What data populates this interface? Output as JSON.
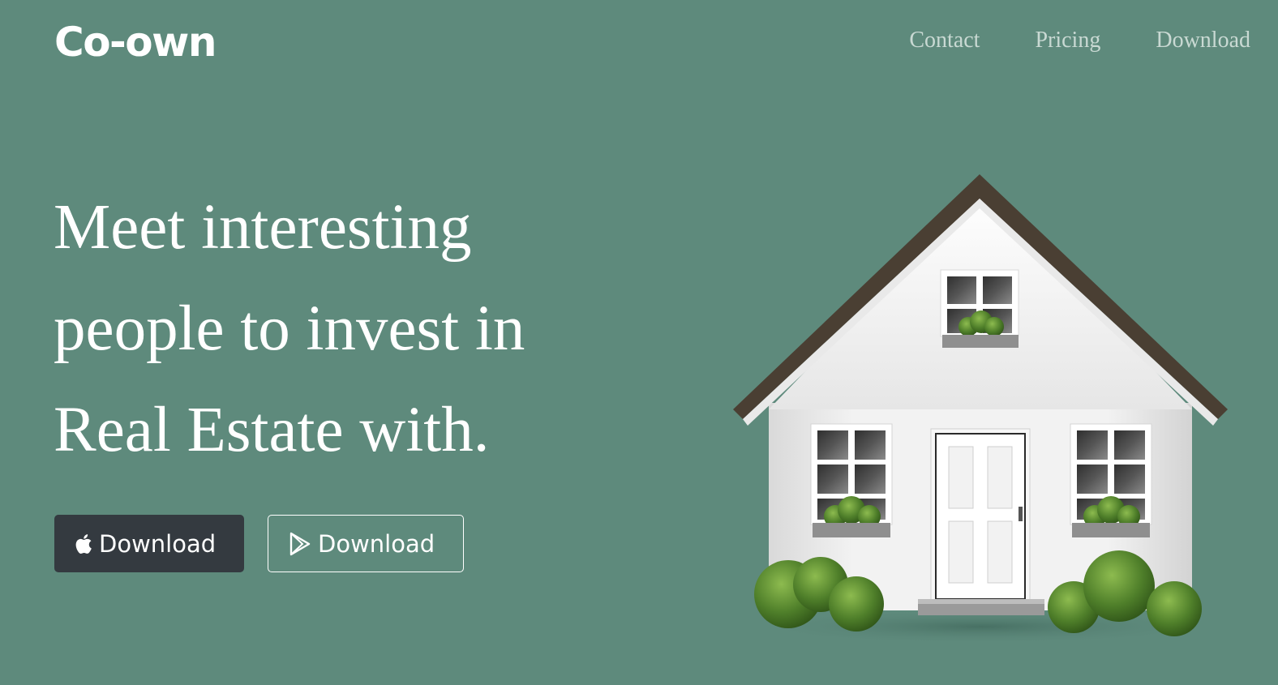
{
  "brand": {
    "logo_text": "Co-own"
  },
  "nav": {
    "items": [
      {
        "label": "Contact"
      },
      {
        "label": "Pricing"
      },
      {
        "label": "Download"
      }
    ]
  },
  "hero": {
    "headline_lines": [
      "Meet interesting",
      "people to invest in",
      "Real Estate with."
    ],
    "buttons": {
      "apple": {
        "label": "Download",
        "icon": "apple-icon"
      },
      "play": {
        "label": "Download",
        "icon": "google-play-icon"
      }
    },
    "illustration": {
      "icon": "house-illustration"
    }
  },
  "colors": {
    "background": "#5e8a7c",
    "nav_text": "#c9d9d3",
    "apple_button": "#343a40",
    "white": "#ffffff"
  }
}
